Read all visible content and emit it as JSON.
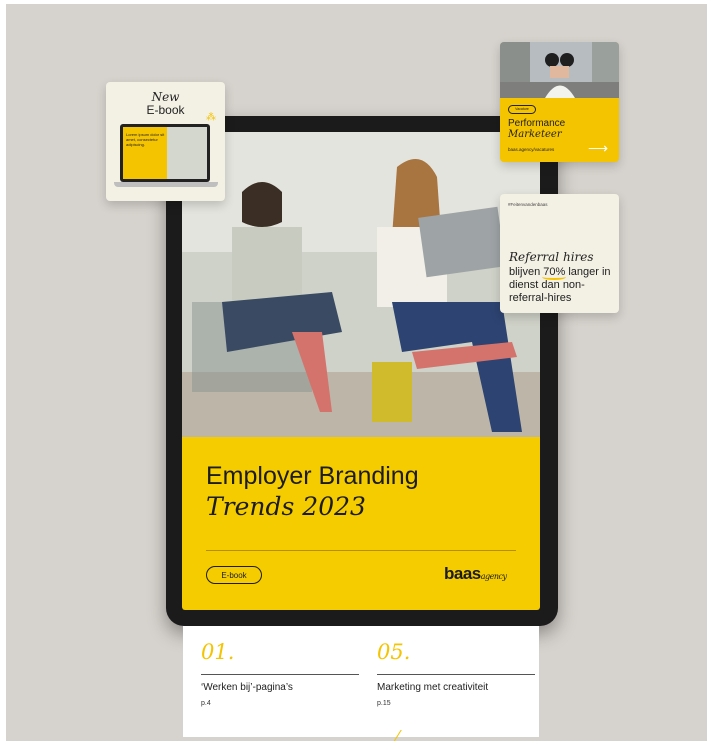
{
  "cover": {
    "title": "Employer Branding",
    "subtitle": "Trends 2023",
    "pill": "E-book",
    "logo_main": "baas",
    "logo_sub": "agency"
  },
  "index": [
    {
      "num": "01.",
      "label": "‘Werken bij’-pagina’s",
      "page": "p.4"
    },
    {
      "num": "05.",
      "label": "Marketing met creativiteit",
      "page": "p.15"
    }
  ],
  "card_ebook": {
    "new": "New",
    "title": "E-book",
    "screen_text": "Lorem ipsum dolor sit amet, consectetur adipiscing."
  },
  "card_vacancy": {
    "pill": "Vacature",
    "line1": "Performance",
    "line2": "Marketeer",
    "handle": "baas.agency/vacatures"
  },
  "card_referral": {
    "tag": "#Feitenvandenbaas",
    "headline": "Referral hires",
    "body_pre": "blijven ",
    "body_highlight": "70%",
    "body_post": " langer in dienst dan non-referral-hires"
  },
  "colors": {
    "brand_yellow": "#f5c400",
    "cream": "#f3f0e4",
    "background": "#d6d2cd"
  },
  "icons": [
    "arrow-right-icon",
    "sparkle-icon",
    "laptop-icon"
  ]
}
